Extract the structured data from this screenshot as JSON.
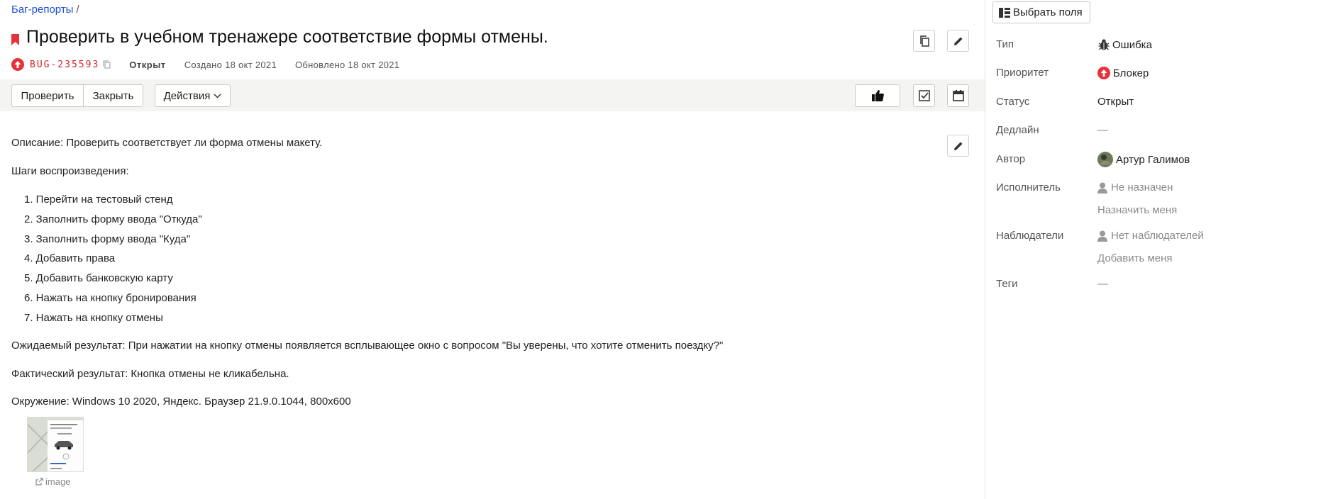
{
  "breadcrumb": {
    "link": "Баг-репорты",
    "sep": "/"
  },
  "issue": {
    "title": "Проверить в учебном тренажере соответствие формы отмены.",
    "key": "BUG-235593",
    "status": "Открыт",
    "created": "Создано 18 окт 2021",
    "updated": "Обновлено 18 окт 2021"
  },
  "toolbar": {
    "check_label": "Проверить",
    "close_label": "Закрыть",
    "actions_label": "Действия"
  },
  "description": {
    "summary": "Описание: Проверить соответствует ли форма отмены макету.",
    "steps_heading": "Шаги воспроизведения:",
    "steps": [
      "1. Перейти на тестовый стенд",
      "2. Заполнить форму ввода \"Откуда\"",
      "3. Заполнить форму ввода \"Куда\"",
      "4. Добавить права",
      "5. Добавить банковскую карту",
      "6. Нажать на кнопку бронирования",
      "7. Нажать на кнопку отмены"
    ],
    "expected": "Ожидаемый результат: При нажатии на кнопку отмены появляется всплывающее окно с вопросом \"Вы уверены, что хотите отменить поездку?\"",
    "actual": "Фактический результат: Кнопка отмены не кликабельна.",
    "environment": "Окружение: Windows 10 2020, Яндекс. Браузер 21.9.0.1044, 800x600",
    "attachment_label": "image"
  },
  "sidebar": {
    "select_fields_label": "Выбрать поля",
    "fields": {
      "type": {
        "label": "Тип",
        "value": "Ошибка"
      },
      "priority": {
        "label": "Приоритет",
        "value": "Блокер"
      },
      "status": {
        "label": "Статус",
        "value": "Открыт"
      },
      "deadline": {
        "label": "Дедлайн",
        "value": "—"
      },
      "author": {
        "label": "Автор",
        "value": "Артур Галимов"
      },
      "assignee": {
        "label": "Исполнитель",
        "value": "Не назначен",
        "action": "Назначить меня"
      },
      "watchers": {
        "label": "Наблюдатели",
        "value": "Нет наблюдателей",
        "action": "Добавить меня"
      },
      "tags": {
        "label": "Теги",
        "value": "—"
      }
    }
  },
  "colors": {
    "link": "#1f4fd6",
    "accent_red": "#e8313a",
    "key_red": "#d4242c"
  },
  "icons": [
    "bookmark-icon",
    "priority-up-icon",
    "copy-icon",
    "pencil-icon",
    "thumbs-up-icon",
    "checklist-icon",
    "calendar-icon",
    "chevron-down-icon",
    "columns-icon",
    "bug-icon",
    "user-icon",
    "external-link-icon"
  ]
}
